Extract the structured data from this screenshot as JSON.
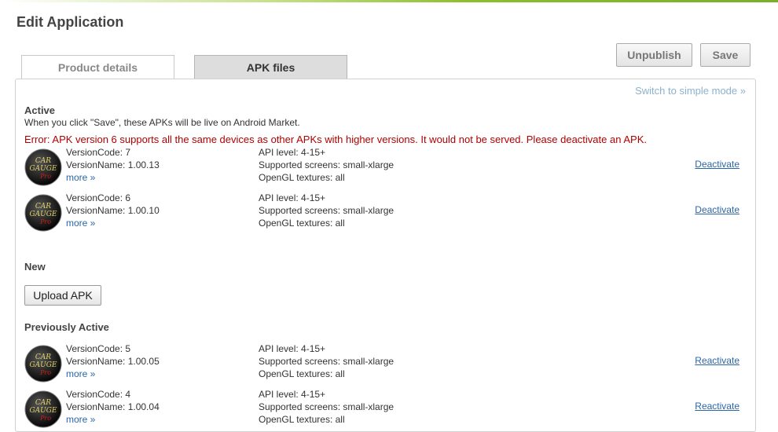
{
  "page": {
    "title": "Edit Application"
  },
  "tabs": [
    {
      "label": "Product details"
    },
    {
      "label": "APK files"
    }
  ],
  "actions": {
    "unpublish": "Unpublish",
    "save": "Save"
  },
  "panel": {
    "switch_mode": "Switch to simple mode »"
  },
  "active": {
    "title": "Active",
    "description": "When you click \"Save\", these APKs will be live on Android Market.",
    "error": "Error: APK version 6 supports all the same devices as other APKs with higher versions. It would not be served. Please deactivate an APK.",
    "apks": [
      {
        "version_code": "VersionCode: 7",
        "version_name": "VersionName: 1.00.13",
        "more": "more »",
        "api": "API level: 4-15+",
        "screens": "Supported screens: small-xlarge",
        "gl": "OpenGL textures: all",
        "action": "Deactivate"
      },
      {
        "version_code": "VersionCode: 6",
        "version_name": "VersionName: 1.00.10",
        "more": "more »",
        "api": "API level: 4-15+",
        "screens": "Supported screens: small-xlarge",
        "gl": "OpenGL textures: all",
        "action": "Deactivate"
      }
    ]
  },
  "new": {
    "title": "New",
    "upload": "Upload APK"
  },
  "previous": {
    "title": "Previously Active",
    "apks": [
      {
        "version_code": "VersionCode: 5",
        "version_name": "VersionName: 1.00.05",
        "more": "more »",
        "api": "API level: 4-15+",
        "screens": "Supported screens: small-xlarge",
        "gl": "OpenGL textures: all",
        "action": "Reactivate"
      },
      {
        "version_code": "VersionCode: 4",
        "version_name": "VersionName: 1.00.04",
        "more": "more »",
        "api": "API level: 4-15+",
        "screens": "Supported screens: small-xlarge",
        "gl": "OpenGL textures: all",
        "action": "Reactivate"
      }
    ]
  },
  "app_icon": {
    "name": "car-gauge-pro-icon",
    "text_line1": "CAR",
    "text_line2": "GAUGE",
    "text_line3": "Pro",
    "text_color": "#e3d36b",
    "accent_color": "#d21a1a"
  }
}
